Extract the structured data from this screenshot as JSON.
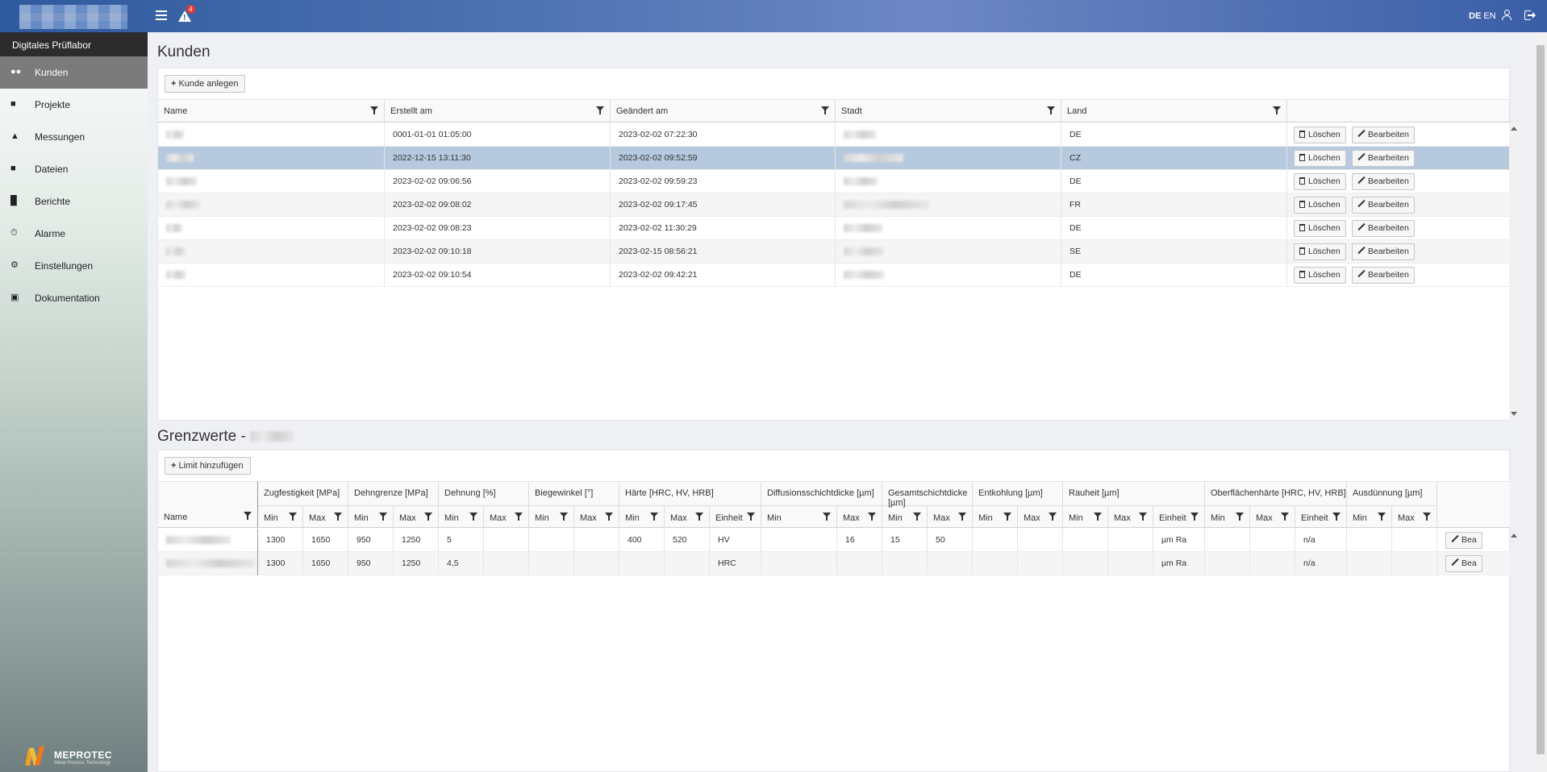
{
  "topbar": {
    "alert_count": "4",
    "lang_de": "DE",
    "lang_en": "EN"
  },
  "sidebar": {
    "title": "Digitales Prüflabor",
    "items": [
      {
        "label": "Kunden",
        "icon": "users-icon"
      },
      {
        "label": "Projekte",
        "icon": "folder-icon"
      },
      {
        "label": "Messungen",
        "icon": "flask-icon"
      },
      {
        "label": "Dateien",
        "icon": "puzzle-icon"
      },
      {
        "label": "Berichte",
        "icon": "file-icon"
      },
      {
        "label": "Alarme",
        "icon": "alarm-clock-icon"
      },
      {
        "label": "Einstellungen",
        "icon": "gear-icon"
      },
      {
        "label": "Dokumentation",
        "icon": "book-icon"
      }
    ],
    "brand": "MEPROTEC",
    "brand_sub": "Metal Process Technology"
  },
  "customers": {
    "title": "Kunden",
    "add_button": "Kunde anlegen",
    "columns": [
      "Name",
      "Erstellt am",
      "Geändert am",
      "Stadt",
      "Land"
    ],
    "delete_label": "Löschen",
    "edit_label": "Bearbeiten",
    "rows": [
      {
        "created": "0001-01-01 01:05:00",
        "changed": "2023-02-02 07:22:30",
        "country": "DE"
      },
      {
        "created": "2022-12-15 13:11:30",
        "changed": "2023-02-02 09:52:59",
        "country": "CZ"
      },
      {
        "created": "2023-02-02 09:06:56",
        "changed": "2023-02-02 09:59:23",
        "country": "DE"
      },
      {
        "created": "2023-02-02 09:08:02",
        "changed": "2023-02-02 09:17:45",
        "country": "FR"
      },
      {
        "created": "2023-02-02 09:08:23",
        "changed": "2023-02-02 11:30:29",
        "country": "DE"
      },
      {
        "created": "2023-02-02 09:10:18",
        "changed": "2023-02-15 08:56:21",
        "country": "SE"
      },
      {
        "created": "2023-02-02 09:10:54",
        "changed": "2023-02-02 09:42:21",
        "country": "DE"
      }
    ]
  },
  "limits": {
    "title": "Grenzwerte -",
    "add_button": "Limit hinzufügen",
    "name_col": "Name",
    "groups": [
      "Zugfestigkeit [MPa]",
      "Dehngrenze [MPa]",
      "Dehnung [%]",
      "Biegewinkel [°]",
      "Härte [HRC, HV, HRB]",
      "Diffusionsschichtdicke [µm]",
      "Gesamtschichtdicke [µm]",
      "Entkohlung [µm]",
      "Rauheit [µm]",
      "Oberflächenhärte [HRC, HV, HRB]",
      "Ausdünnung [µm]"
    ],
    "sub": [
      "Min",
      "Max",
      "Min",
      "Max",
      "Min",
      "Max",
      "Min",
      "Max",
      "Min",
      "Max",
      "Einheit",
      "Min",
      "Max",
      "Min",
      "Max",
      "Min",
      "Max",
      "Min",
      "Max",
      "Einheit",
      "Min",
      "Max",
      "Einheit",
      "Min",
      "Max"
    ],
    "edit_label": "Bea",
    "rows": [
      [
        "1300",
        "1650",
        "950",
        "1250",
        "5",
        "",
        "",
        "",
        "400",
        "520",
        "HV",
        "",
        "16",
        "15",
        "50",
        "",
        "",
        "",
        "",
        "µm Ra",
        "",
        "",
        "n/a",
        "",
        ""
      ],
      [
        "1300",
        "1650",
        "950",
        "1250",
        "4,5",
        "",
        "",
        "",
        "",
        "",
        "HRC",
        "",
        "",
        "",
        "",
        "",
        "",
        "",
        "",
        "µm Ra",
        "",
        "",
        "n/a",
        "",
        ""
      ]
    ]
  }
}
